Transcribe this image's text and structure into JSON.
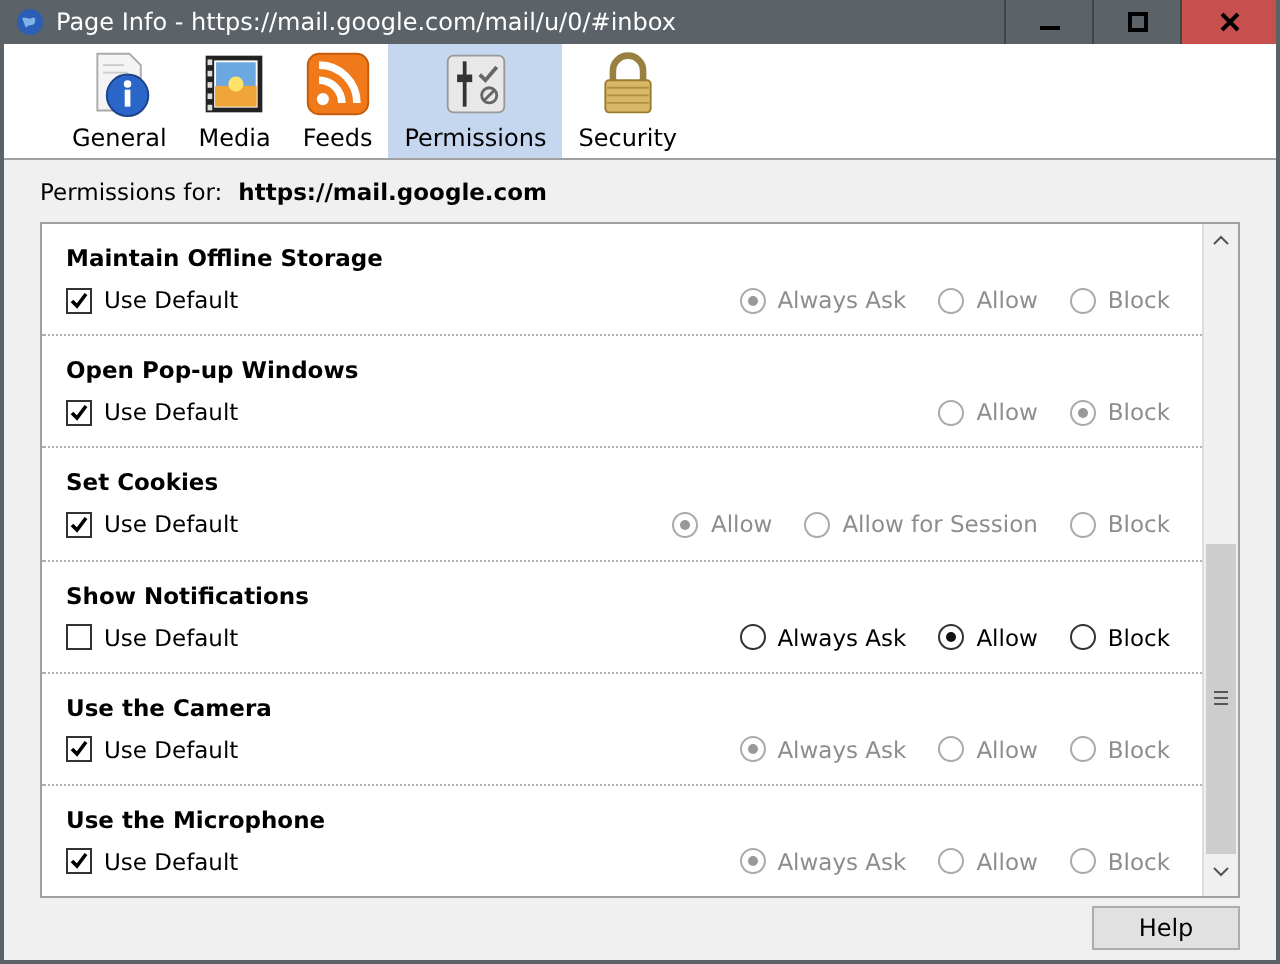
{
  "window": {
    "title": "Page Info - https://mail.google.com/mail/u/0/#inbox"
  },
  "tabs": [
    {
      "label": "General",
      "kind": "general",
      "selected": false
    },
    {
      "label": "Media",
      "kind": "media",
      "selected": false
    },
    {
      "label": "Feeds",
      "kind": "feeds",
      "selected": false
    },
    {
      "label": "Permissions",
      "kind": "permissions",
      "selected": true
    },
    {
      "label": "Security",
      "kind": "security",
      "selected": false
    }
  ],
  "permissions_for": {
    "label": "Permissions for:",
    "site": "https://mail.google.com"
  },
  "permissions": [
    {
      "title": "Maintain Offline Storage",
      "use_default": {
        "label": "Use Default",
        "checked": true
      },
      "options": [
        {
          "label": "Always Ask",
          "selected": true
        },
        {
          "label": "Allow",
          "selected": false
        },
        {
          "label": "Block",
          "selected": false
        }
      ]
    },
    {
      "title": "Open Pop-up Windows",
      "use_default": {
        "label": "Use Default",
        "checked": true
      },
      "options": [
        {
          "label": "Allow",
          "selected": false
        },
        {
          "label": "Block",
          "selected": true
        }
      ]
    },
    {
      "title": "Set Cookies",
      "use_default": {
        "label": "Use Default",
        "checked": true
      },
      "options": [
        {
          "label": "Allow",
          "selected": true
        },
        {
          "label": "Allow for Session",
          "selected": false
        },
        {
          "label": "Block",
          "selected": false
        }
      ]
    },
    {
      "title": "Show Notifications",
      "use_default": {
        "label": "Use Default",
        "checked": false
      },
      "options": [
        {
          "label": "Always Ask",
          "selected": false
        },
        {
          "label": "Allow",
          "selected": true
        },
        {
          "label": "Block",
          "selected": false
        }
      ]
    },
    {
      "title": "Use the Camera",
      "use_default": {
        "label": "Use Default",
        "checked": true
      },
      "options": [
        {
          "label": "Always Ask",
          "selected": true
        },
        {
          "label": "Allow",
          "selected": false
        },
        {
          "label": "Block",
          "selected": false
        }
      ]
    },
    {
      "title": "Use the Microphone",
      "use_default": {
        "label": "Use Default",
        "checked": true
      },
      "options": [
        {
          "label": "Always Ask",
          "selected": true
        },
        {
          "label": "Allow",
          "selected": false
        },
        {
          "label": "Block",
          "selected": false
        }
      ]
    }
  ],
  "buttons": [
    "Help"
  ]
}
